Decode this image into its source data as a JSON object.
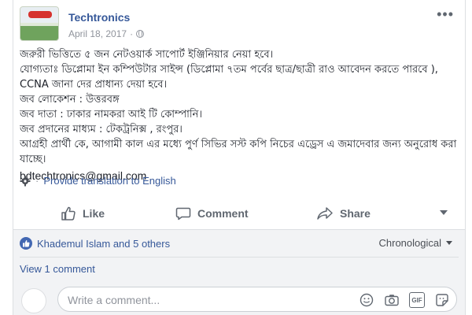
{
  "post": {
    "page_name": "Techtronics",
    "date": "April 18, 2017",
    "separator": "·",
    "body_lines": [
      "জরুরী ভিত্তিতে ৫ জন নেটওয়ার্ক সাপোর্ট ইঞ্জিনিয়ার নেয়া হবে।",
      "যোগ্যতাঃ ডিপ্লোমা ইন কম্পিউটার সাইন্স (ডিপ্লোমা ৭তম পর্বের ছাত্র/ছাত্রী রাও আবেদন করতে পারবে ), CCNA জানা দের প্রাধান্য দেয়া হবে।",
      "জব লোকেশন : উত্তরবঙ্গ",
      "জব দাতা : ঢাকার নামকরা আই টি কোম্পানি।",
      "জব প্রদানের মাধ্যম : টেকট্রনিক্স , রংপুর।",
      "আগ্রহী প্রার্থী কে, আগামী কাল এর মধ্যে পুর্ণ সিভির সস্ট কপি নিচের এড্রেস এ জমাদেবার জন্য অনুরোধ করা যাচ্ছে।"
    ],
    "email": "bdtechtronics@gmail.com",
    "translate_label": "Provide translation to English"
  },
  "actions": {
    "like": "Like",
    "comment": "Comment",
    "share": "Share"
  },
  "reactions": {
    "summary": "Khademul Islam and 5 others",
    "sort_label": "Chronological"
  },
  "comments": {
    "view_label": "View 1 comment",
    "composer_placeholder": "Write a comment..."
  },
  "icons": {
    "more": "more-options-icon",
    "audience": "globe-icon",
    "translate": "gear-icon",
    "composer": [
      "emoji-icon",
      "camera-icon",
      "gif-icon",
      "sticker-icon"
    ]
  },
  "colors": {
    "link": "#365899",
    "muted": "#90949c",
    "action": "#606770",
    "like_badge": "#4267b2"
  }
}
